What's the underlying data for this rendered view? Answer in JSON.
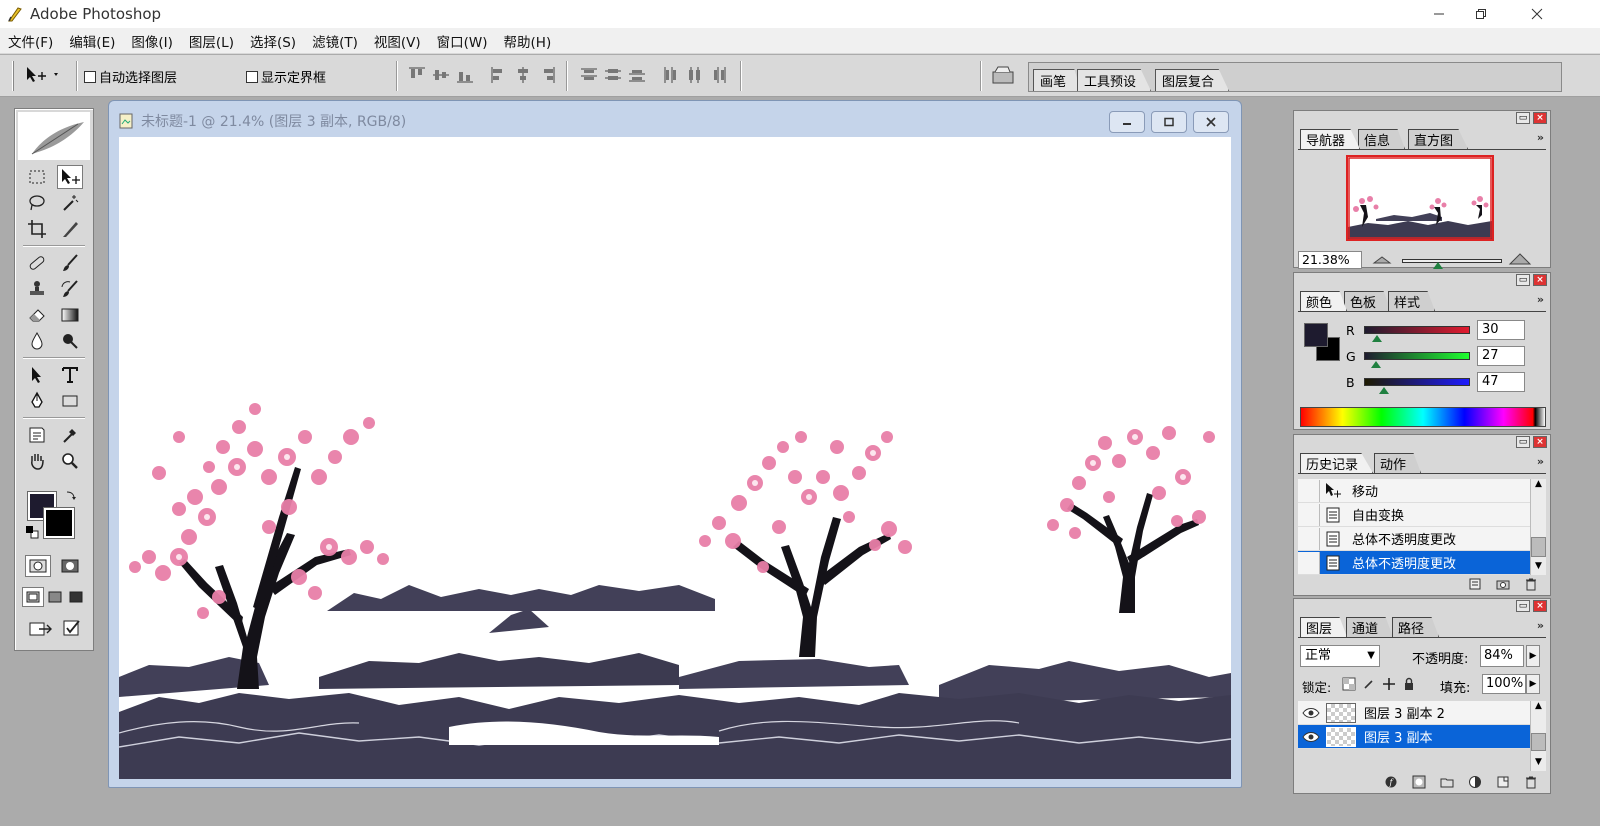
{
  "window": {
    "title": "Adobe Photoshop"
  },
  "menu": [
    "文件(F)",
    "编辑(E)",
    "图像(I)",
    "图层(L)",
    "选择(S)",
    "滤镜(T)",
    "视图(V)",
    "窗口(W)",
    "帮助(H)"
  ],
  "options": {
    "auto_select_label": "自动选择图层",
    "show_bounds_label": "显示定界框",
    "well_tabs": [
      "画笔",
      "工具预设",
      "图层复合"
    ]
  },
  "document": {
    "title": "未标题-1 @ 21.4% (图层 3 副本, RGB/8)"
  },
  "navigator": {
    "tabs": [
      "导航器",
      "信息",
      "直方图"
    ],
    "zoom": "21.38%"
  },
  "color": {
    "tabs": [
      "颜色",
      "色板",
      "样式"
    ],
    "channels": [
      {
        "label": "R",
        "value": "30",
        "level": 0.118,
        "bar": "linear-gradient(to right,#1e1b2f,#e21b2f)"
      },
      {
        "label": "G",
        "value": "27",
        "level": 0.106,
        "bar": "linear-gradient(to right,#1e1b2f,#1eff2f)"
      },
      {
        "label": "B",
        "value": "47",
        "level": 0.184,
        "bar": "linear-gradient(to right,#1e1b00,#1e1bff)"
      }
    ],
    "foreground": "#1e1b2f",
    "background": "#000000"
  },
  "history": {
    "tabs": [
      "历史记录",
      "动作"
    ],
    "items": [
      "移动",
      "自由变换",
      "总体不透明度更改",
      "总体不透明度更改"
    ],
    "selected_index": 3
  },
  "layers": {
    "tabs": [
      "图层",
      "通道",
      "路径"
    ],
    "blend_mode": "正常",
    "opacity_label": "不透明度:",
    "opacity": "84%",
    "lock_label": "锁定:",
    "fill_label": "填充:",
    "fill": "100%",
    "rows": [
      "图层 3 副本 2",
      "图层 3 副本"
    ]
  }
}
